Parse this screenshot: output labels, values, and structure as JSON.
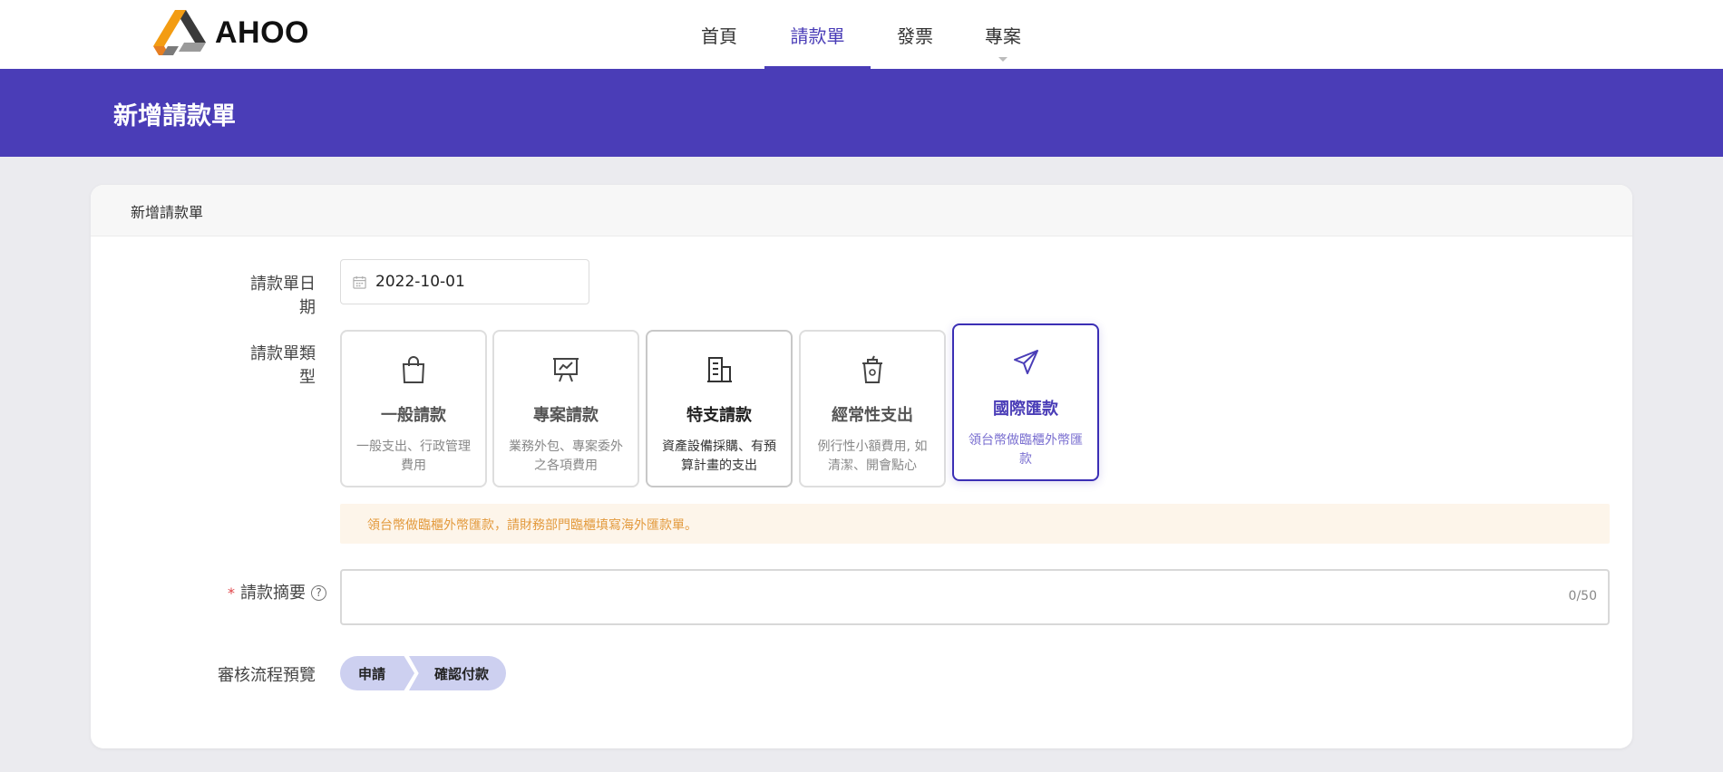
{
  "brand": {
    "name": "AHOO"
  },
  "nav": {
    "items": [
      {
        "label": "首頁",
        "active": false
      },
      {
        "label": "請款單",
        "active": true
      },
      {
        "label": "發票",
        "active": false
      },
      {
        "label": "專案",
        "active": false
      }
    ]
  },
  "page": {
    "title": "新增請款單"
  },
  "card": {
    "title": "新增請款單"
  },
  "form": {
    "date_label": "請款單日期",
    "date_value": "2022-10-01",
    "type_label": "請款單類型",
    "types": [
      {
        "icon": "shopping-bag-icon",
        "title": "一般請款",
        "desc": "一般支出、行政管理費用"
      },
      {
        "icon": "presentation-board-icon",
        "title": "專案請款",
        "desc": "業務外包、專案委外之各項費用"
      },
      {
        "icon": "building-icon",
        "title": "特支請款",
        "desc": "資產設備採購、有預算計畫的支出"
      },
      {
        "icon": "cup-icon",
        "title": "經常性支出",
        "desc": "例行性小額費用, 如清潔、開會點心"
      },
      {
        "icon": "send-arrow-icon",
        "title": "國際匯款",
        "desc": "領台幣做臨櫃外幣匯款",
        "selected": true
      }
    ],
    "notice": "領台幣做臨櫃外幣匯款，請財務部門臨櫃填寫海外匯款單。",
    "summary_required_mark": "*",
    "summary_label": "請款摘要",
    "summary_help_icon": "?",
    "summary_value": "",
    "summary_counter": "0/50",
    "flow_label": "審核流程預覽",
    "flow_steps": [
      "申請",
      "確認付款"
    ]
  },
  "colors": {
    "primary": "#4a3db7",
    "notice_bg": "#fdf5ea",
    "notice_text": "#e39a3d",
    "step_bg": "#cdd0f0"
  }
}
